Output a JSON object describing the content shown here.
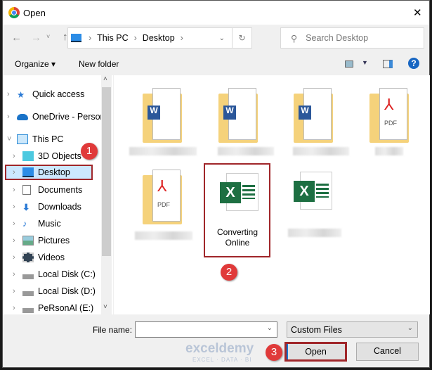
{
  "window": {
    "title": "Open",
    "close": "✕"
  },
  "address": {
    "segments": [
      "This PC",
      "Desktop"
    ],
    "search_placeholder": "Search Desktop"
  },
  "toolbar": {
    "organize": "Organize ▾",
    "new_folder": "New folder",
    "help": "?"
  },
  "sidebar": {
    "items": [
      {
        "label": "Quick access",
        "icon": "star-icon"
      },
      {
        "label": "OneDrive - Persor",
        "icon": "cloud-icon"
      },
      {
        "label": "This PC",
        "icon": "computer-icon"
      },
      {
        "label": "3D Objects",
        "icon": "cube-icon"
      },
      {
        "label": "Desktop",
        "icon": "desktop-icon"
      },
      {
        "label": "Documents",
        "icon": "document-icon"
      },
      {
        "label": "Downloads",
        "icon": "download-icon"
      },
      {
        "label": "Music",
        "icon": "music-icon"
      },
      {
        "label": "Pictures",
        "icon": "pictures-icon"
      },
      {
        "label": "Videos",
        "icon": "videos-icon"
      },
      {
        "label": "Local Disk (C:)",
        "icon": "disk-icon"
      },
      {
        "label": "Local Disk (D:)",
        "icon": "disk-icon"
      },
      {
        "label": "PeRsonAl (E:)",
        "icon": "disk-icon"
      }
    ]
  },
  "files": {
    "selected_name": "Converting Online",
    "pdf_label": "PDF",
    "excel_letter": "X"
  },
  "bottom": {
    "file_name_label": "File name:",
    "file_name_value": "",
    "file_type": "Custom Files",
    "open": "Open",
    "cancel": "Cancel"
  },
  "steps": [
    "1",
    "2",
    "3"
  ],
  "watermark": {
    "name": "exceldemy",
    "tagline": "EXCEL · DATA · BI"
  }
}
